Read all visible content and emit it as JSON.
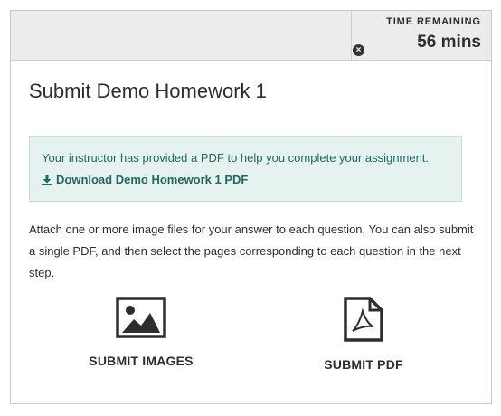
{
  "timer": {
    "label": "TIME REMAINING",
    "value": "56 mins",
    "close_icon": "close-circle-icon"
  },
  "page": {
    "title": "Submit Demo Homework 1"
  },
  "notice": {
    "text": "Your instructor has provided a PDF to help you complete your assignment.",
    "link_label": "Download Demo Homework 1 PDF",
    "link_icon": "download-icon",
    "colors": {
      "background": "#e6f2ef",
      "text": "#1d6a62"
    }
  },
  "instructions": "Attach one or more image files for your answer to each question. You can also submit a single PDF, and then select the pages corresponding to each question in the next step.",
  "options": {
    "images": {
      "label": "SUBMIT IMAGES",
      "icon": "image-icon"
    },
    "pdf": {
      "label": "SUBMIT PDF",
      "icon": "pdf-file-icon"
    }
  }
}
